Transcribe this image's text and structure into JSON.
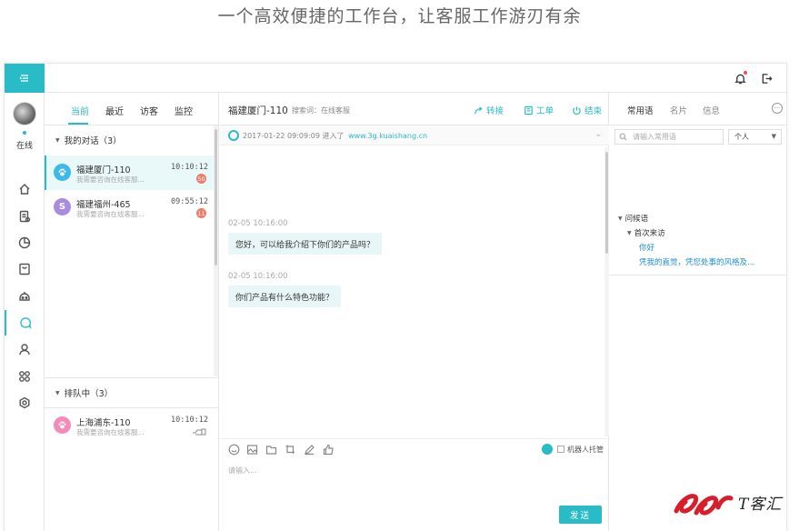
{
  "headline": "一个高效便捷的工作台，让客服工作游刃有余",
  "colors": {
    "accent": "#29bcc6",
    "badge": "#f07c6a",
    "link": "#1f8fd6",
    "bubble": "#e9f6f7"
  },
  "rail": {
    "status": "在线",
    "icons": [
      "home-icon",
      "document-icon",
      "pie-chart-icon",
      "inbox-icon",
      "robot-icon",
      "chat-icon",
      "user-icon",
      "apps-icon",
      "settings-icon"
    ]
  },
  "conversations": {
    "tabs": [
      "当前",
      "最近",
      "访客",
      "监控"
    ],
    "groups": [
      {
        "title": "我的对话（3）",
        "items": [
          {
            "name": "福建厦门-110",
            "msg": "我需要咨询在线客服...",
            "time": "10:10:12",
            "badge": "50",
            "avatar": "paw-icon",
            "color": "#3cb9e8"
          },
          {
            "name": "福建福州-465",
            "msg": "我需要咨询在线客服...",
            "time": "09:55:12",
            "badge": "11",
            "avatar": "S",
            "color": "#a98be0"
          }
        ]
      },
      {
        "title": "排队中（3）",
        "items": [
          {
            "name": "上海浦东-110",
            "msg": "我需要咨询在线客服...",
            "time": "10:10:12",
            "avatar": "paw-icon",
            "color": "#f28bb8"
          }
        ]
      }
    ]
  },
  "chat": {
    "title": "福建厦门-110",
    "search_label": "搜索词：在线客服",
    "actions": [
      "转接",
      "工单",
      "结束"
    ],
    "visit": {
      "time": "2017-01-22 09:09:09",
      "verb": "进入了",
      "url": "www.3g.kuaishang.cn"
    },
    "messages": [
      {
        "time": "02-05 10:16:00",
        "text": "您好，可以给我介绍下你们的产品吗？"
      },
      {
        "time": "02-05 10:16:00",
        "text": "你们产品有什么特色功能？"
      }
    ],
    "robot_label": "机器人托管",
    "input_placeholder": "请输入...",
    "send_label": "发送"
  },
  "side": {
    "tabs": [
      "常用语",
      "名片",
      "信息"
    ],
    "search_placeholder": "请输入常用语",
    "scope": "个人",
    "tree": [
      {
        "label": "问候语",
        "level": 0,
        "caret": true
      },
      {
        "label": "首次来访",
        "level": 1,
        "caret": true
      },
      {
        "label": "你好",
        "level": 2,
        "link": true
      },
      {
        "label": "凭我的直觉，凭您处事的风格及...",
        "level": 2,
        "link": true
      }
    ]
  },
  "watermark": {
    "text": "T客汇"
  }
}
